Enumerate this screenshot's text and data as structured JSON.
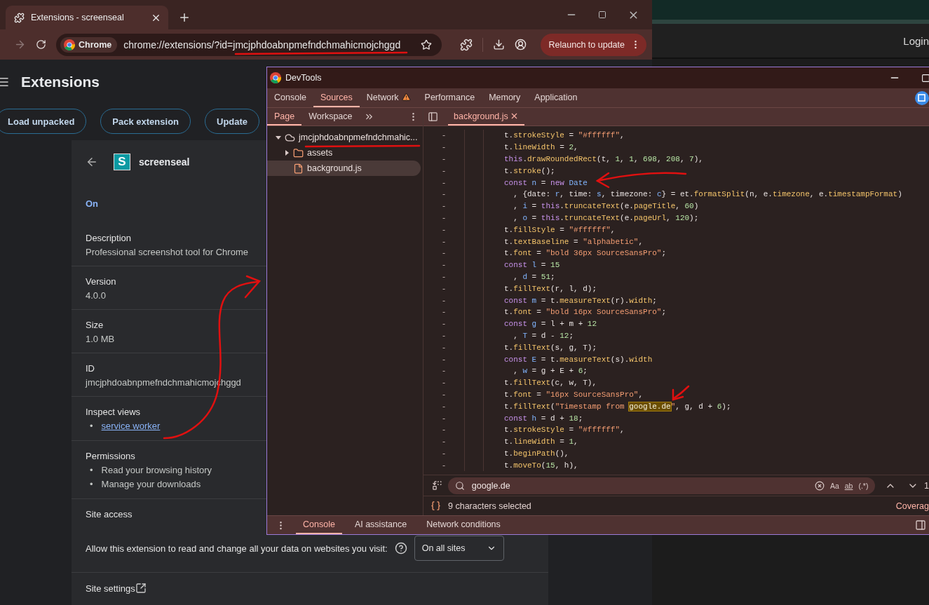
{
  "background_window": {
    "login": "Login"
  },
  "browser": {
    "tab": {
      "title": "Extensions - screenseal"
    },
    "chip": "Chrome",
    "url_prefix": "chrome://extensions/?id=",
    "url_id": "jmcjphdoabnpmefndchmahicmojchggd",
    "relaunch": "Relaunch to update"
  },
  "extensions_page": {
    "title": "Extensions",
    "buttons": [
      "Load unpacked",
      "Pack extension",
      "Update"
    ],
    "extension": {
      "logo": "S",
      "name": "screenseal",
      "status": "On",
      "sections": [
        {
          "kind": "text",
          "label": "Description",
          "value": "Professional screenshot tool for Chrome"
        },
        {
          "kind": "text",
          "label": "Version",
          "value": "4.0.0"
        },
        {
          "kind": "text",
          "label": "Size",
          "value": "1.0 MB"
        },
        {
          "kind": "text",
          "label": "ID",
          "value": "jmcjphdoabnpmefndchmahicmojchggd"
        },
        {
          "kind": "links",
          "label": "Inspect views",
          "items": [
            {
              "bullet": "•",
              "text": "service worker"
            }
          ]
        },
        {
          "kind": "list",
          "label": "Permissions",
          "items": [
            {
              "bullet": "•",
              "text": "Read your browsing history"
            },
            {
              "bullet": "•",
              "text": "Manage your downloads"
            }
          ]
        },
        {
          "kind": "access",
          "label": "Site access",
          "prompt": "Allow this extension to read and change all your data on websites you visit:",
          "select": "On all sites"
        },
        {
          "kind": "external",
          "label": "Site settings"
        }
      ]
    }
  },
  "devtools": {
    "title": "DevTools",
    "tabs": [
      {
        "label": "Console",
        "selected": false,
        "warning": false
      },
      {
        "label": "Sources",
        "selected": true,
        "warning": false
      },
      {
        "label": "Network",
        "selected": false,
        "warning": true
      },
      {
        "label": "Performance",
        "selected": false,
        "warning": false
      },
      {
        "label": "Memory",
        "selected": false,
        "warning": false
      },
      {
        "label": "Application",
        "selected": false,
        "warning": false
      }
    ],
    "navigator": {
      "tabs": [
        {
          "label": "Page",
          "selected": true
        },
        {
          "label": "Workspace",
          "selected": false
        }
      ],
      "tree": [
        {
          "kind": "origin",
          "label": "jmcjphdoabnpmefndchmahic...",
          "expanded": true,
          "selected": false,
          "children": [
            {
              "kind": "folder",
              "label": "assets",
              "expanded": false,
              "selected": false
            },
            {
              "kind": "file",
              "label": "background.js",
              "selected": true
            }
          ]
        }
      ]
    },
    "editor": {
      "file": "background.js",
      "lines": [
        {
          "marker": "-",
          "tokens": [
            {
              "kind": "plain",
              "text": "t."
            },
            {
              "kind": "property",
              "text": "strokeStyle"
            },
            {
              "kind": "plain",
              "text": " = "
            },
            {
              "kind": "string",
              "text": "\"#ffffff\""
            },
            {
              "kind": "plain",
              "text": ","
            }
          ]
        },
        {
          "marker": "-",
          "tokens": [
            {
              "kind": "plain",
              "text": "t."
            },
            {
              "kind": "property",
              "text": "lineWidth"
            },
            {
              "kind": "plain",
              "text": " = "
            },
            {
              "kind": "number",
              "text": "2"
            },
            {
              "kind": "plain",
              "text": ","
            }
          ]
        },
        {
          "marker": "-",
          "tokens": [
            {
              "kind": "keyword",
              "text": "this"
            },
            {
              "kind": "plain",
              "text": "."
            },
            {
              "kind": "property",
              "text": "drawRoundedRect"
            },
            {
              "kind": "plain",
              "text": "(t, "
            },
            {
              "kind": "number",
              "text": "1"
            },
            {
              "kind": "plain",
              "text": ", "
            },
            {
              "kind": "number",
              "text": "1"
            },
            {
              "kind": "plain",
              "text": ", "
            },
            {
              "kind": "number",
              "text": "698"
            },
            {
              "kind": "plain",
              "text": ", "
            },
            {
              "kind": "number",
              "text": "208"
            },
            {
              "kind": "plain",
              "text": ", "
            },
            {
              "kind": "number",
              "text": "7"
            },
            {
              "kind": "plain",
              "text": "),"
            }
          ]
        },
        {
          "marker": "-",
          "tokens": [
            {
              "kind": "plain",
              "text": "t."
            },
            {
              "kind": "property",
              "text": "stroke"
            },
            {
              "kind": "plain",
              "text": "();"
            }
          ]
        },
        {
          "marker": "-",
          "tokens": [
            {
              "kind": "keyword",
              "text": "const "
            },
            {
              "kind": "variable",
              "text": "n"
            },
            {
              "kind": "plain",
              "text": " = "
            },
            {
              "kind": "keyword",
              "text": "new "
            },
            {
              "kind": "variable",
              "text": "Date"
            }
          ]
        },
        {
          "marker": "-",
          "tokens": [
            {
              "kind": "plain",
              "text": "  , {date: "
            },
            {
              "kind": "variable",
              "text": "r"
            },
            {
              "kind": "plain",
              "text": ", time: "
            },
            {
              "kind": "variable",
              "text": "s"
            },
            {
              "kind": "plain",
              "text": ", timezone: "
            },
            {
              "kind": "variable",
              "text": "c"
            },
            {
              "kind": "plain",
              "text": "} = et."
            },
            {
              "kind": "property",
              "text": "formatSplit"
            },
            {
              "kind": "plain",
              "text": "(n, e."
            },
            {
              "kind": "property",
              "text": "timezone"
            },
            {
              "kind": "plain",
              "text": ", e."
            },
            {
              "kind": "property",
              "text": "timestampFormat"
            },
            {
              "kind": "plain",
              "text": ")"
            }
          ]
        },
        {
          "marker": "-",
          "tokens": [
            {
              "kind": "plain",
              "text": "  , "
            },
            {
              "kind": "variable",
              "text": "i"
            },
            {
              "kind": "plain",
              "text": " = "
            },
            {
              "kind": "keyword",
              "text": "this"
            },
            {
              "kind": "plain",
              "text": "."
            },
            {
              "kind": "property",
              "text": "truncateText"
            },
            {
              "kind": "plain",
              "text": "(e."
            },
            {
              "kind": "property",
              "text": "pageTitle"
            },
            {
              "kind": "plain",
              "text": ", "
            },
            {
              "kind": "number",
              "text": "60"
            },
            {
              "kind": "plain",
              "text": ")"
            }
          ]
        },
        {
          "marker": "-",
          "tokens": [
            {
              "kind": "plain",
              "text": "  , "
            },
            {
              "kind": "variable",
              "text": "o"
            },
            {
              "kind": "plain",
              "text": " = "
            },
            {
              "kind": "keyword",
              "text": "this"
            },
            {
              "kind": "plain",
              "text": "."
            },
            {
              "kind": "property",
              "text": "truncateText"
            },
            {
              "kind": "plain",
              "text": "(e."
            },
            {
              "kind": "property",
              "text": "pageUrl"
            },
            {
              "kind": "plain",
              "text": ", "
            },
            {
              "kind": "number",
              "text": "120"
            },
            {
              "kind": "plain",
              "text": ");"
            }
          ]
        },
        {
          "marker": "-",
          "tokens": [
            {
              "kind": "plain",
              "text": "t."
            },
            {
              "kind": "property",
              "text": "fillStyle"
            },
            {
              "kind": "plain",
              "text": " = "
            },
            {
              "kind": "string",
              "text": "\"#ffffff\""
            },
            {
              "kind": "plain",
              "text": ","
            }
          ]
        },
        {
          "marker": "-",
          "tokens": [
            {
              "kind": "plain",
              "text": "t."
            },
            {
              "kind": "property",
              "text": "textBaseline"
            },
            {
              "kind": "plain",
              "text": " = "
            },
            {
              "kind": "string",
              "text": "\"alphabetic\""
            },
            {
              "kind": "plain",
              "text": ","
            }
          ]
        },
        {
          "marker": "-",
          "tokens": [
            {
              "kind": "plain",
              "text": "t."
            },
            {
              "kind": "property",
              "text": "font"
            },
            {
              "kind": "plain",
              "text": " = "
            },
            {
              "kind": "string",
              "text": "\"bold 36px SourceSansPro\""
            },
            {
              "kind": "plain",
              "text": ";"
            }
          ]
        },
        {
          "marker": "-",
          "tokens": [
            {
              "kind": "keyword",
              "text": "const "
            },
            {
              "kind": "variable",
              "text": "l"
            },
            {
              "kind": "plain",
              "text": " = "
            },
            {
              "kind": "number",
              "text": "15"
            }
          ]
        },
        {
          "marker": "-",
          "tokens": [
            {
              "kind": "plain",
              "text": "  , "
            },
            {
              "kind": "variable",
              "text": "d"
            },
            {
              "kind": "plain",
              "text": " = "
            },
            {
              "kind": "number",
              "text": "51"
            },
            {
              "kind": "plain",
              "text": ";"
            }
          ]
        },
        {
          "marker": "-",
          "tokens": [
            {
              "kind": "plain",
              "text": "t."
            },
            {
              "kind": "property",
              "text": "fillText"
            },
            {
              "kind": "plain",
              "text": "(r, l, d);"
            }
          ]
        },
        {
          "marker": "-",
          "tokens": [
            {
              "kind": "keyword",
              "text": "const "
            },
            {
              "kind": "variable",
              "text": "m"
            },
            {
              "kind": "plain",
              "text": " = t."
            },
            {
              "kind": "property",
              "text": "measureText"
            },
            {
              "kind": "plain",
              "text": "(r)."
            },
            {
              "kind": "property",
              "text": "width"
            },
            {
              "kind": "plain",
              "text": ";"
            }
          ]
        },
        {
          "marker": "-",
          "tokens": [
            {
              "kind": "plain",
              "text": "t."
            },
            {
              "kind": "property",
              "text": "font"
            },
            {
              "kind": "plain",
              "text": " = "
            },
            {
              "kind": "string",
              "text": "\"bold 16px SourceSansPro\""
            },
            {
              "kind": "plain",
              "text": ";"
            }
          ]
        },
        {
          "marker": "-",
          "tokens": [
            {
              "kind": "keyword",
              "text": "const "
            },
            {
              "kind": "variable",
              "text": "g"
            },
            {
              "kind": "plain",
              "text": " = l + m + "
            },
            {
              "kind": "number",
              "text": "12"
            }
          ]
        },
        {
          "marker": "-",
          "tokens": [
            {
              "kind": "plain",
              "text": "  , "
            },
            {
              "kind": "variable",
              "text": "T"
            },
            {
              "kind": "plain",
              "text": " = d - "
            },
            {
              "kind": "number",
              "text": "12"
            },
            {
              "kind": "plain",
              "text": ";"
            }
          ]
        },
        {
          "marker": "-",
          "tokens": [
            {
              "kind": "plain",
              "text": "t."
            },
            {
              "kind": "property",
              "text": "fillText"
            },
            {
              "kind": "plain",
              "text": "(s, g, T);"
            }
          ]
        },
        {
          "marker": "-",
          "tokens": [
            {
              "kind": "keyword",
              "text": "const "
            },
            {
              "kind": "variable",
              "text": "E"
            },
            {
              "kind": "plain",
              "text": " = t."
            },
            {
              "kind": "property",
              "text": "measureText"
            },
            {
              "kind": "plain",
              "text": "(s)."
            },
            {
              "kind": "property",
              "text": "width"
            }
          ]
        },
        {
          "marker": "-",
          "tokens": [
            {
              "kind": "plain",
              "text": "  , "
            },
            {
              "kind": "variable",
              "text": "w"
            },
            {
              "kind": "plain",
              "text": " = g + E + "
            },
            {
              "kind": "number",
              "text": "6"
            },
            {
              "kind": "plain",
              "text": ";"
            }
          ]
        },
        {
          "marker": "-",
          "tokens": [
            {
              "kind": "plain",
              "text": "t."
            },
            {
              "kind": "property",
              "text": "fillText"
            },
            {
              "kind": "plain",
              "text": "(c, w, T),"
            }
          ]
        },
        {
          "marker": "-",
          "tokens": [
            {
              "kind": "plain",
              "text": "t."
            },
            {
              "kind": "property",
              "text": "font"
            },
            {
              "kind": "plain",
              "text": " = "
            },
            {
              "kind": "string",
              "text": "\"16px SourceSansPro\""
            },
            {
              "kind": "plain",
              "text": ","
            }
          ]
        },
        {
          "marker": "-",
          "tokens": [
            {
              "kind": "plain",
              "text": "t."
            },
            {
              "kind": "property",
              "text": "fillText"
            },
            {
              "kind": "plain",
              "text": "("
            },
            {
              "kind": "string",
              "text": "\"Timestamp from "
            },
            {
              "kind": "match",
              "text": "google.de"
            },
            {
              "kind": "string",
              "text": "\""
            },
            {
              "kind": "plain",
              "text": ", g, d + "
            },
            {
              "kind": "number",
              "text": "6"
            },
            {
              "kind": "plain",
              "text": ");"
            }
          ]
        },
        {
          "marker": "-",
          "tokens": [
            {
              "kind": "keyword",
              "text": "const "
            },
            {
              "kind": "variable",
              "text": "h"
            },
            {
              "kind": "plain",
              "text": " = d + "
            },
            {
              "kind": "number",
              "text": "18"
            },
            {
              "kind": "plain",
              "text": ";"
            }
          ]
        },
        {
          "marker": "-",
          "tokens": [
            {
              "kind": "plain",
              "text": "t."
            },
            {
              "kind": "property",
              "text": "strokeStyle"
            },
            {
              "kind": "plain",
              "text": " = "
            },
            {
              "kind": "string",
              "text": "\"#ffffff\""
            },
            {
              "kind": "plain",
              "text": ","
            }
          ]
        },
        {
          "marker": "-",
          "tokens": [
            {
              "kind": "plain",
              "text": "t."
            },
            {
              "kind": "property",
              "text": "lineWidth"
            },
            {
              "kind": "plain",
              "text": " = "
            },
            {
              "kind": "number",
              "text": "1"
            },
            {
              "kind": "plain",
              "text": ","
            }
          ]
        },
        {
          "marker": "-",
          "tokens": [
            {
              "kind": "plain",
              "text": "t."
            },
            {
              "kind": "property",
              "text": "beginPath"
            },
            {
              "kind": "plain",
              "text": "(),"
            }
          ]
        },
        {
          "marker": "-",
          "tokens": [
            {
              "kind": "plain",
              "text": "t."
            },
            {
              "kind": "property",
              "text": "moveTo"
            },
            {
              "kind": "plain",
              "text": "("
            },
            {
              "kind": "number",
              "text": "15"
            },
            {
              "kind": "plain",
              "text": ", h),"
            }
          ]
        }
      ]
    },
    "search": {
      "value": "google.de",
      "case": "Aa",
      "word": "ab",
      "regex": "(.*)",
      "count": "1"
    },
    "status": {
      "text": "9 characters selected",
      "coverage": "Coverag"
    },
    "drawer_tabs": [
      {
        "label": "Console",
        "selected": true
      },
      {
        "label": "AI assistance",
        "selected": false
      },
      {
        "label": "Network conditions",
        "selected": false
      }
    ]
  }
}
